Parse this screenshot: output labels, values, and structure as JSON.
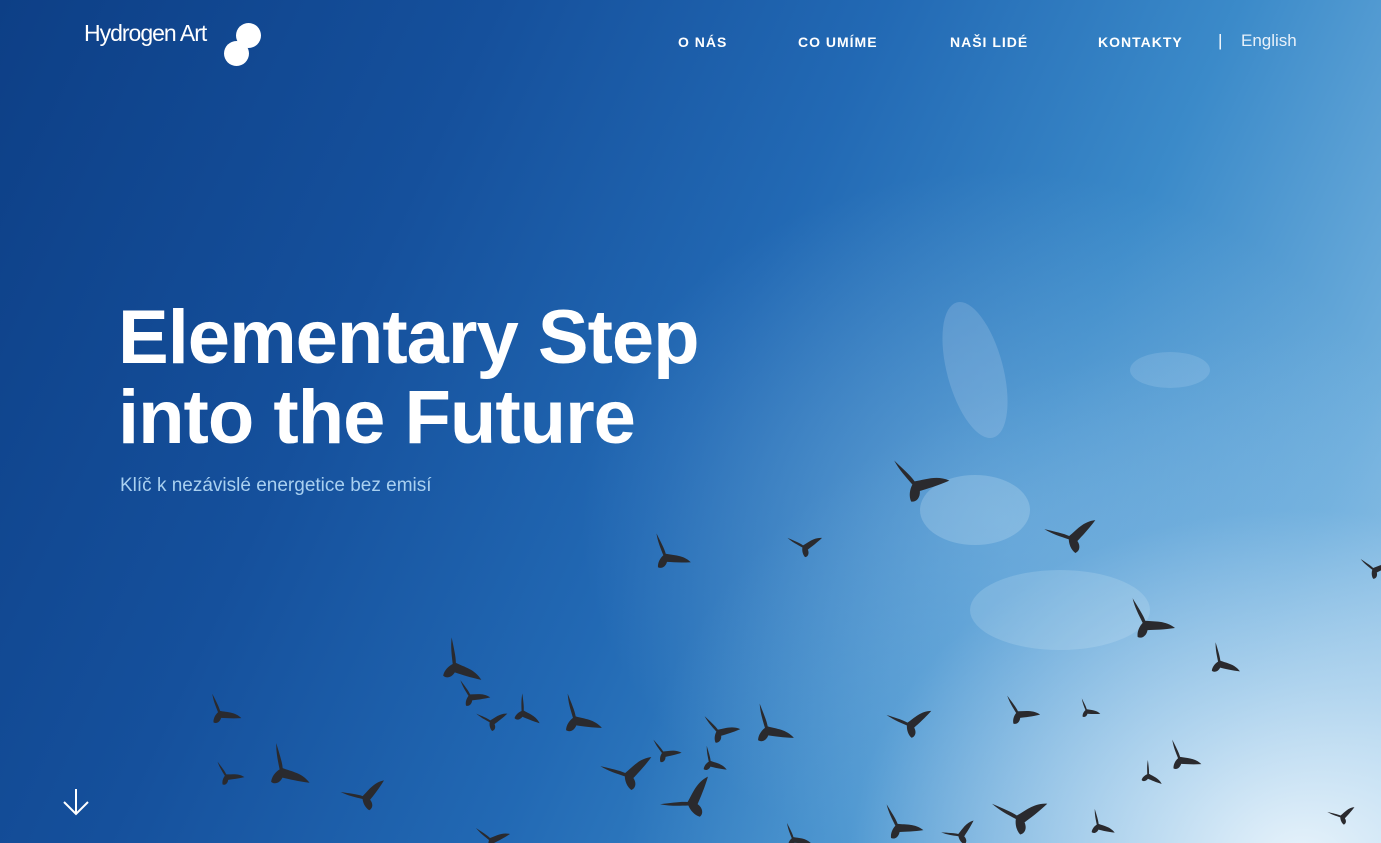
{
  "brand": {
    "name": "Hydrogen Art"
  },
  "nav": {
    "items": [
      {
        "label": "O NÁS"
      },
      {
        "label": "CO UMÍME"
      },
      {
        "label": "NAŠI LIDÉ"
      },
      {
        "label": "KONTAKTY"
      }
    ],
    "separator": "|",
    "language": "English"
  },
  "hero": {
    "title_line1": "Elementary Step",
    "title_line2": "into the Future",
    "subtitle": "Klíč k nezávislé energetice bez emisí",
    "scroll_icon": "arrow-down-icon"
  },
  "colors": {
    "sky_dark": "#0d3f86",
    "sky_light": "#a8d0ec",
    "subtitle": "#a9d0f0",
    "text": "#ffffff"
  }
}
